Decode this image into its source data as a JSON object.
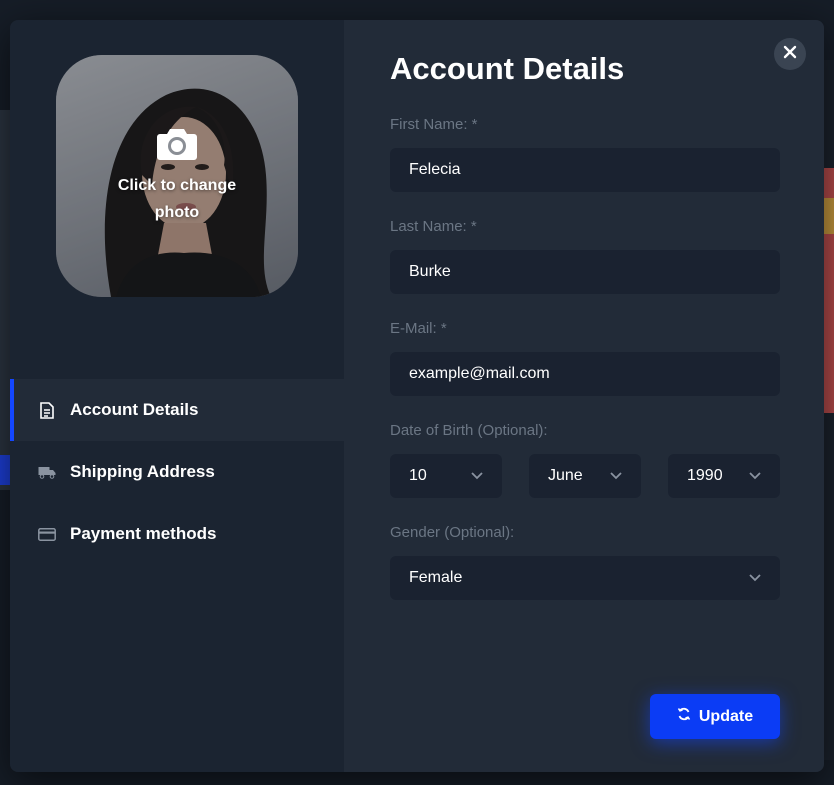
{
  "modal": {
    "title": "Account Details",
    "close_icon": "close-icon"
  },
  "photo": {
    "change_label": "Click to change photo",
    "camera_icon": "camera-icon"
  },
  "nav": {
    "items": [
      {
        "label": "Account Details",
        "icon": "document-icon",
        "active": true
      },
      {
        "label": "Shipping Address",
        "icon": "truck-icon",
        "active": false
      },
      {
        "label": "Payment methods",
        "icon": "credit-card-icon",
        "active": false
      }
    ]
  },
  "form": {
    "first_name": {
      "label": "First Name: *",
      "value": "Felecia"
    },
    "last_name": {
      "label": "Last Name: *",
      "value": "Burke"
    },
    "email": {
      "label": "E-Mail: *",
      "value": "example@mail.com"
    },
    "dob": {
      "label": "Date of Birth (Optional):",
      "day": "10",
      "month": "June",
      "year": "1990"
    },
    "gender": {
      "label": "Gender (Optional):",
      "value": "Female"
    }
  },
  "actions": {
    "update_label": "Update",
    "update_icon": "refresh-icon"
  },
  "colors": {
    "accent": "#0b3cf5",
    "modal_left_bg": "#1b2431",
    "modal_right_bg": "#222b38",
    "input_bg": "#1a2230",
    "label_text": "#6b7684"
  }
}
